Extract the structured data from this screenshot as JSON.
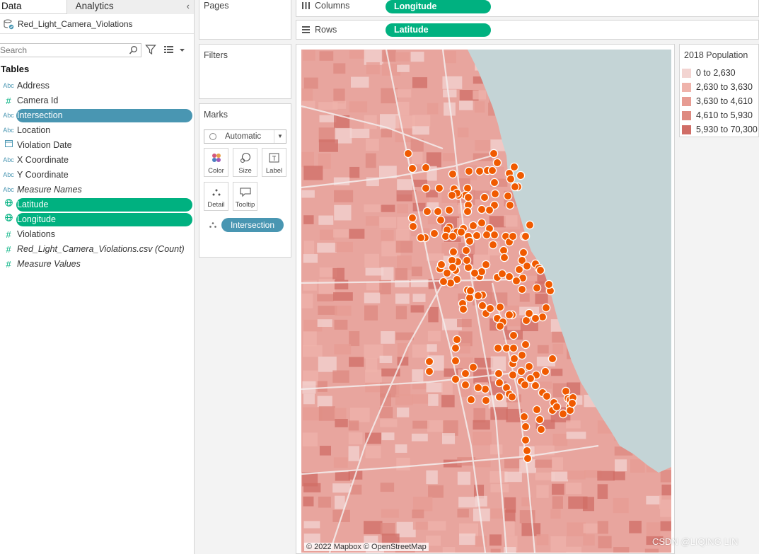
{
  "datapane": {
    "tabs": [
      {
        "label": "Data"
      },
      {
        "label": "Analytics"
      }
    ],
    "collapse_glyph": "‹",
    "datasource": "Red_Light_Camera_Violations",
    "search_placeholder": "Search",
    "tables_heading": "Tables",
    "fields": [
      {
        "type": "Abc",
        "name": "Address",
        "style": "normal"
      },
      {
        "type": "#",
        "name": "Camera Id",
        "style": "normal"
      },
      {
        "type": "Abc",
        "name": "Intersection",
        "style": "pill-blue"
      },
      {
        "type": "Abc",
        "name": "Location",
        "style": "normal"
      },
      {
        "type": "date",
        "name": "Violation Date",
        "style": "normal"
      },
      {
        "type": "Abc",
        "name": "X Coordinate",
        "style": "normal"
      },
      {
        "type": "Abc",
        "name": "Y Coordinate",
        "style": "normal"
      },
      {
        "type": "Abc",
        "name": "Measure Names",
        "style": "italic"
      },
      {
        "type": "geo",
        "name": "Latitude",
        "style": "pill-green"
      },
      {
        "type": "geo",
        "name": "Longitude",
        "style": "pill-green"
      },
      {
        "type": "#",
        "name": "Violations",
        "style": "normal"
      },
      {
        "type": "#",
        "name": "Red_Light_Camera_Violations.csv (Count)",
        "style": "italic"
      },
      {
        "type": "#",
        "name": "Measure Values",
        "style": "italic"
      }
    ]
  },
  "cards": {
    "pages": "Pages",
    "filters": "Filters",
    "marks": "Marks",
    "mark_type": "Automatic",
    "mark_buttons": {
      "color": "Color",
      "size": "Size",
      "label": "Label",
      "detail": "Detail",
      "tooltip": "Tooltip"
    },
    "detail_pill": "Intersection"
  },
  "shelves": {
    "columns_label": "Columns",
    "columns_pill": "Longitude",
    "rows_label": "Rows",
    "rows_pill": "Latitude"
  },
  "map": {
    "attribution": "© 2022 Mapbox © OpenStreetMap",
    "point_color": "#f05a00",
    "water_color": "#c4d4d6",
    "land_color": "#e8a59e"
  },
  "legend": {
    "title": "2018 Population",
    "items": [
      {
        "label": "0 to 2,630",
        "color": "#f3d4d1"
      },
      {
        "label": "2,630 to 3,630",
        "color": "#efb3ab"
      },
      {
        "label": "3,630 to 4,610",
        "color": "#e79c93"
      },
      {
        "label": "4,610 to 5,930",
        "color": "#de8a80"
      },
      {
        "label": "5,930 to 70,300",
        "color": "#d06d66"
      }
    ]
  },
  "watermark": "CSDN @LIQING LIN"
}
